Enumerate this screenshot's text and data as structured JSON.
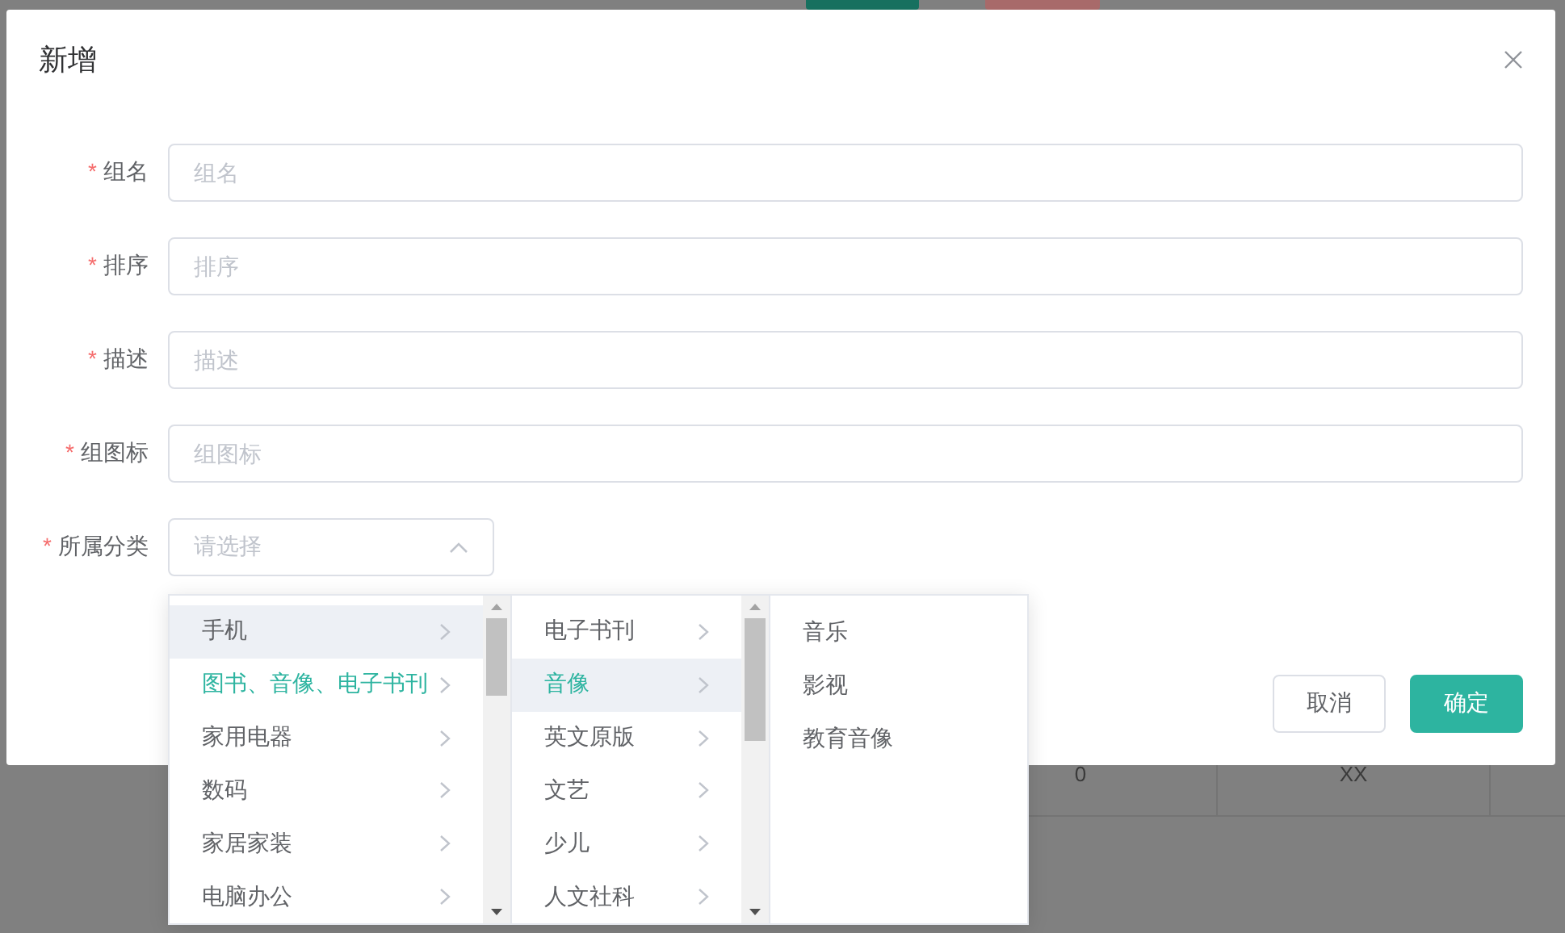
{
  "background": {
    "table_cells": [
      "0",
      "XX"
    ]
  },
  "dialog": {
    "title": "新增",
    "fields": [
      {
        "kind": "input",
        "required_mark": "*",
        "label": "组名",
        "placeholder": "组名"
      },
      {
        "kind": "input",
        "required_mark": "*",
        "label": "排序",
        "placeholder": "排序"
      },
      {
        "kind": "input",
        "required_mark": "*",
        "label": "描述",
        "placeholder": "描述"
      },
      {
        "kind": "input",
        "required_mark": "*",
        "label": "组图标",
        "placeholder": "组图标"
      },
      {
        "kind": "select",
        "required_mark": "*",
        "label": "所属分类",
        "placeholder": "请选择",
        "expanded": true
      }
    ],
    "buttons": [
      {
        "label": "取消",
        "kind": "default"
      },
      {
        "label": "确定",
        "kind": "primary"
      }
    ]
  },
  "cascader": {
    "columns": [
      {
        "scrollable": true,
        "items": [
          {
            "label": "手机",
            "selected": false,
            "hovered": true,
            "has_children": true
          },
          {
            "label": "图书、音像、电子书刊",
            "selected": true,
            "hovered": false,
            "has_children": true
          },
          {
            "label": "家用电器",
            "selected": false,
            "hovered": false,
            "has_children": true
          },
          {
            "label": "数码",
            "selected": false,
            "hovered": false,
            "has_children": true
          },
          {
            "label": "家居家装",
            "selected": false,
            "hovered": false,
            "has_children": true
          },
          {
            "label": "电脑办公",
            "selected": false,
            "hovered": false,
            "has_children": true
          }
        ]
      },
      {
        "scrollable": true,
        "items": [
          {
            "label": "电子书刊",
            "selected": false,
            "hovered": false,
            "has_children": true
          },
          {
            "label": "音像",
            "selected": true,
            "hovered": true,
            "has_children": true
          },
          {
            "label": "英文原版",
            "selected": false,
            "hovered": false,
            "has_children": true
          },
          {
            "label": "文艺",
            "selected": false,
            "hovered": false,
            "has_children": true
          },
          {
            "label": "少儿",
            "selected": false,
            "hovered": false,
            "has_children": true
          },
          {
            "label": "人文社科",
            "selected": false,
            "hovered": false,
            "has_children": true
          }
        ]
      },
      {
        "scrollable": false,
        "items": [
          {
            "label": "音乐",
            "selected": false,
            "hovered": false,
            "has_children": false
          },
          {
            "label": "影视",
            "selected": false,
            "hovered": false,
            "has_children": false
          },
          {
            "label": "教育音像",
            "selected": false,
            "hovered": false,
            "has_children": false
          }
        ]
      }
    ]
  }
}
